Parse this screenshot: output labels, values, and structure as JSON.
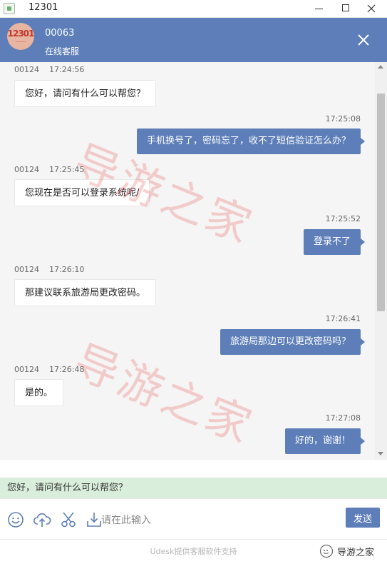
{
  "window": {
    "title": "12301",
    "icons": [
      "app-icon",
      "minimize-icon",
      "maximize-icon",
      "close-icon"
    ]
  },
  "header": {
    "logo_text": "12301",
    "agent_id": "00063",
    "agent_role": "在线客服",
    "close_icon": "close-icon"
  },
  "watermark": {
    "text": "导游之家",
    "color": "#e75a5a"
  },
  "messages": [
    {
      "side": "left",
      "sender": "00124",
      "time": "17:24:56",
      "text": "您好，请问有什么可以帮您？"
    },
    {
      "side": "right",
      "time": "17:25:08",
      "text": "手机换号了，密码忘了，收不了短信验证怎么办？"
    },
    {
      "side": "left",
      "sender": "00124",
      "time": "17:25:45",
      "text": "您现在是否可以登录系统呢/"
    },
    {
      "side": "right",
      "time": "17:25:52",
      "text": "登录不了"
    },
    {
      "side": "left",
      "sender": "00124",
      "time": "17:26:10",
      "text": "那建议联系旅游局更改密码。"
    },
    {
      "side": "right",
      "time": "17:26:41",
      "text": "旅游局那边可以更改密码吗？"
    },
    {
      "side": "left",
      "sender": "00124",
      "time": "17:26:48",
      "text": "是的。"
    },
    {
      "side": "right",
      "time": "17:27:08",
      "text": "好的，谢谢！"
    }
  ],
  "quick_reply": "您好，请问有什么可以帮您？",
  "input": {
    "placeholder": "请在此输入",
    "send_label": "发送",
    "tools": [
      "emoji-icon",
      "upload-cloud-icon",
      "scissors-icon",
      "download-icon"
    ]
  },
  "footer": {
    "powered_by": "Udesk提供客服软件支持",
    "brand": "导游之家"
  },
  "colors": {
    "primary": "#5d7eb8",
    "quick_reply_bg": "#d9eedb",
    "chat_bg": "#f5f5f5"
  }
}
